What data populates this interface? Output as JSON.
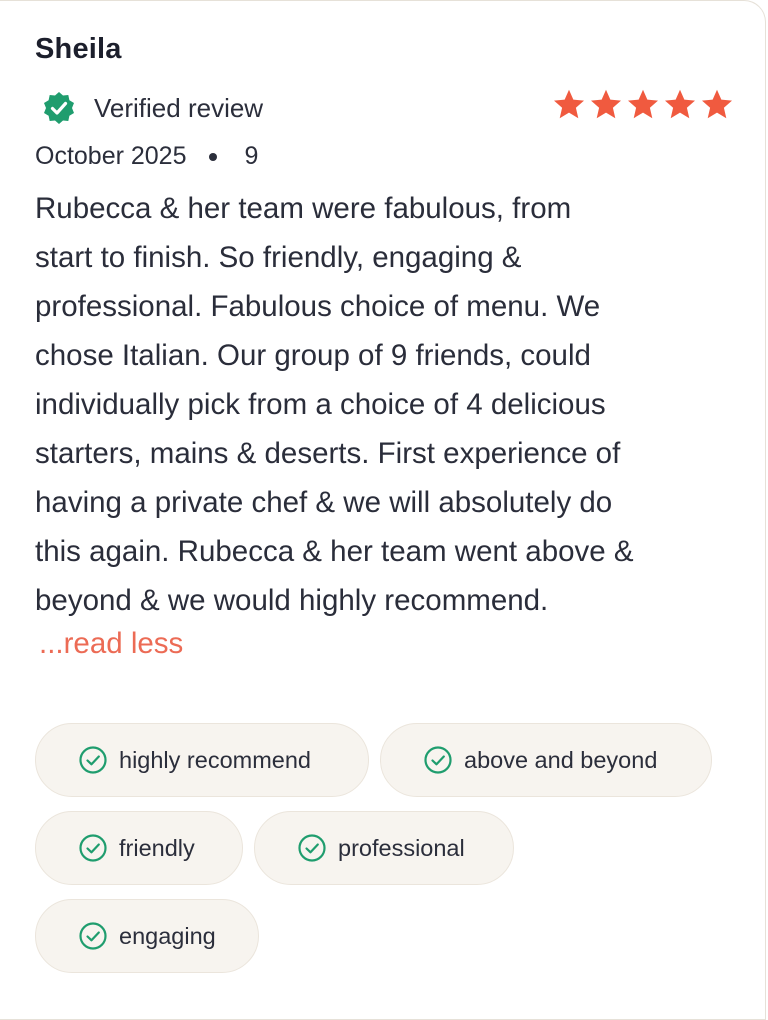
{
  "review": {
    "reviewer_name": "Sheila",
    "verified_label": "Verified review",
    "rating": 5,
    "rating_max": 5,
    "date": "October 2025",
    "guest_count": "9",
    "body_lines": [
      "Rubecca & her team were fabulous, from",
      "start to finish. So friendly, engaging &",
      "professional. Fabulous choice of menu. We",
      "chose Italian. Our group of 9 friends, could",
      "individually pick from a choice of 4 delicious",
      "starters, mains & deserts. First experience of",
      "having a private chef & we will absolutely do",
      "this again. Rubecca & her team went above &",
      "beyond & we would highly recommend."
    ],
    "read_less_label": "...read less",
    "tags": [
      {
        "label": "highly recommend",
        "icon": "check-circle-icon"
      },
      {
        "label": "above and beyond",
        "icon": "check-circle-icon"
      },
      {
        "label": "friendly",
        "icon": "check-circle-icon"
      },
      {
        "label": "professional",
        "icon": "check-circle-icon"
      },
      {
        "label": "engaging",
        "icon": "check-circle-icon"
      }
    ]
  },
  "colors": {
    "star": "#f05a3f",
    "verified_badge": "#1f9d6e",
    "read_less": "#ec6b55",
    "tag_check": "#1f9d6e",
    "tag_background": "#f7f4ef",
    "text": "#2a2d3a"
  }
}
